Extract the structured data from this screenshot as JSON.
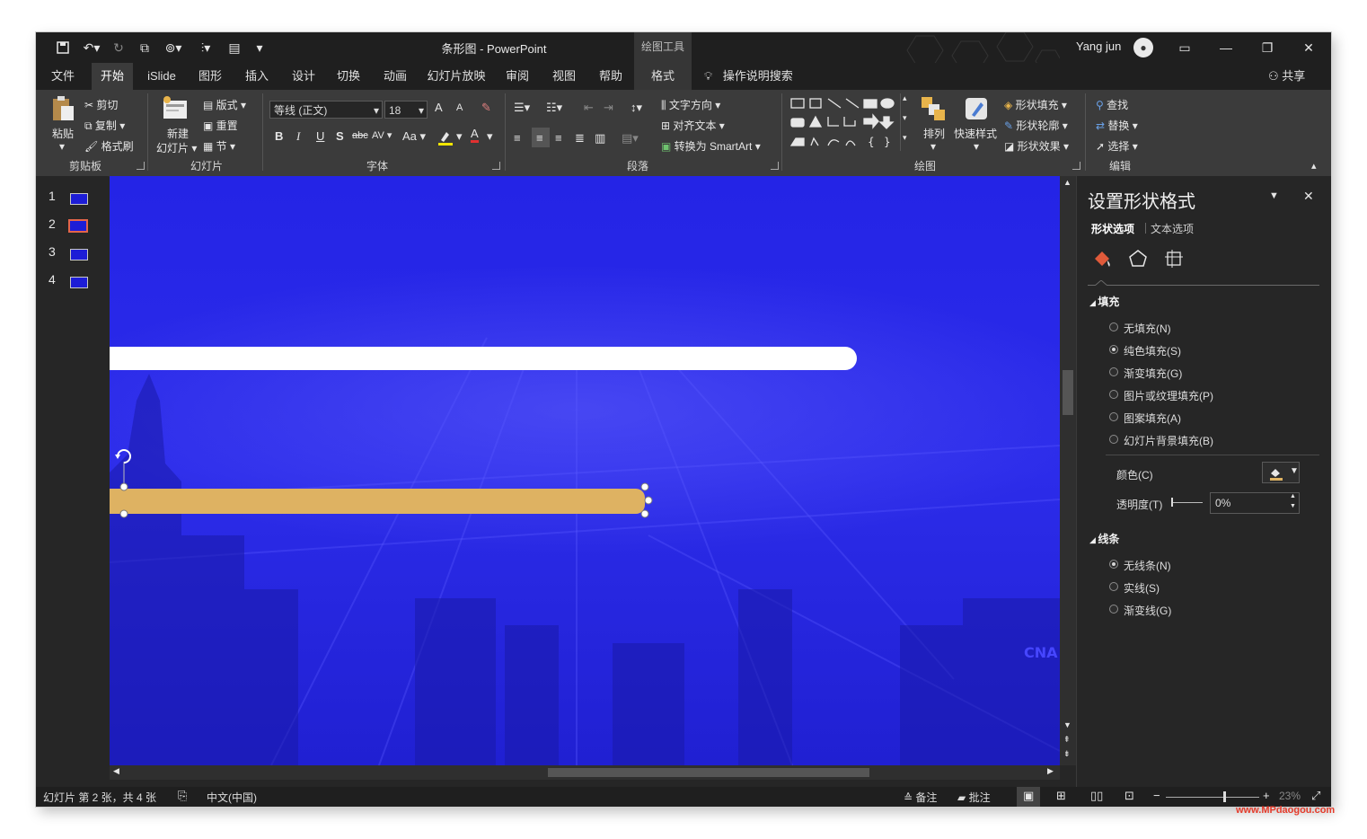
{
  "window": {
    "title": "条形图 - PowerPoint",
    "context_tools": "绘图工具",
    "user": "Yang jun"
  },
  "tabs": [
    "文件",
    "开始",
    "iSlide",
    "图形",
    "插入",
    "设计",
    "切换",
    "动画",
    "幻灯片放映",
    "审阅",
    "视图",
    "帮助"
  ],
  "tab_format": "格式",
  "tell_me": "操作说明搜索",
  "share": "共享",
  "ribbon": {
    "clipboard": {
      "paste": "粘贴",
      "cut": "剪切",
      "copy": "复制",
      "format_painter": "格式刷",
      "group": "剪贴板"
    },
    "slides": {
      "new_slide_1": "新建",
      "new_slide_2": "幻灯片",
      "layout": "版式",
      "reset": "重置",
      "section": "节",
      "group": "幻灯片"
    },
    "font": {
      "name": "等线 (正文)",
      "size": "18",
      "group": "字体",
      "bold": "B",
      "italic": "I",
      "underline": "U",
      "shadow": "S",
      "strike": "abc",
      "spacing": "AV",
      "case": "Aa",
      "grow": "A",
      "shrink": "A",
      "font_color": "A"
    },
    "paragraph": {
      "text_direction": "文字方向",
      "align_text": "对齐文本",
      "smartart": "转换为 SmartArt",
      "group": "段落"
    },
    "drawing": {
      "arrange": "排列",
      "quick_styles": "快速样式",
      "shape_fill": "形状填充",
      "shape_outline": "形状轮廓",
      "shape_effects": "形状效果",
      "group": "绘图"
    },
    "editing": {
      "find": "查找",
      "replace": "替换",
      "select": "选择",
      "group": "编辑"
    }
  },
  "thumbnails": [
    "1",
    "2",
    "3",
    "4"
  ],
  "format_pane": {
    "title": "设置形状格式",
    "tab_shape": "形状选项",
    "tab_text": "文本选项",
    "fill_section": "填充",
    "fill_options": [
      "无填充(N)",
      "纯色填充(S)",
      "渐变填充(G)",
      "图片或纹理填充(P)",
      "图案填充(A)",
      "幻灯片背景填充(B)"
    ],
    "fill_selected_index": 1,
    "color_label": "颜色(C)",
    "transparency_label": "透明度(T)",
    "transparency_value": "0%",
    "line_section": "线条",
    "line_options": [
      "无线条(N)",
      "实线(S)",
      "渐变线(G)"
    ],
    "line_selected_index": 0
  },
  "status": {
    "slide_info": "幻灯片 第 2 张，共 4 张",
    "language": "中文(中国)",
    "notes": "备注",
    "comments": "批注",
    "zoom": "23%"
  },
  "slide": {
    "background_color": "#2a2ae8",
    "bar_white_color": "#ffffff",
    "bar_gold_color": "#deb262",
    "watermark_text": "CNA"
  },
  "watermark": "www.MPdaogou.com"
}
